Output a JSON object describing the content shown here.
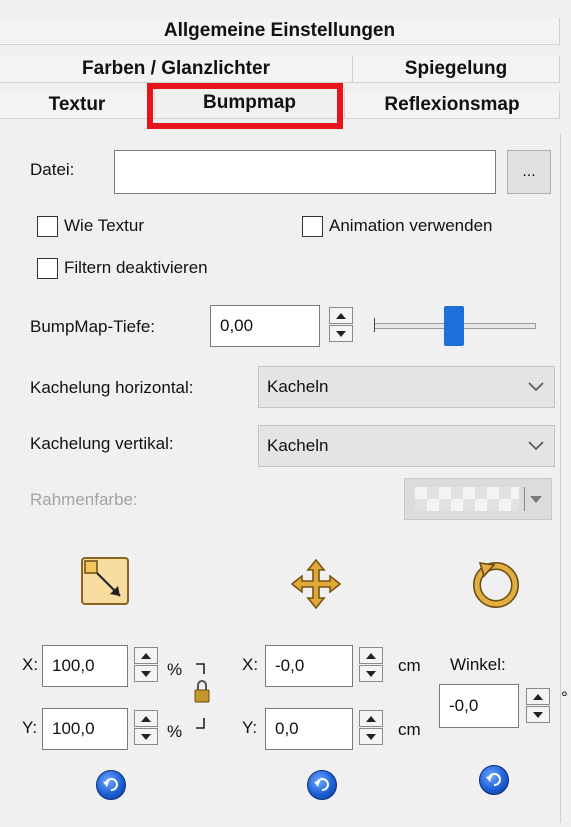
{
  "tabs": {
    "row1": [
      {
        "label": "Allgemeine Einstellungen"
      }
    ],
    "row2": [
      {
        "label": "Farben / Glanzlichter"
      },
      {
        "label": "Spiegelung"
      }
    ],
    "row3": [
      {
        "label": "Textur"
      },
      {
        "label": "Bumpmap",
        "active": true
      },
      {
        "label": "Reflexionsmap"
      }
    ]
  },
  "file": {
    "label": "Datei:",
    "value": "",
    "browse": "..."
  },
  "checkboxes": {
    "wie_textur": "Wie Textur",
    "animation": "Animation verwenden",
    "filtern": "Filtern deaktivieren"
  },
  "bump_depth": {
    "label": "BumpMap-Tiefe:",
    "value": "0,00",
    "slider_fraction": 0.5
  },
  "tiling_h": {
    "label": "Kachelung horizontal:",
    "value": "Kacheln"
  },
  "tiling_v": {
    "label": "Kachelung vertikal:",
    "value": "Kacheln"
  },
  "frame_color": {
    "label": "Rahmenfarbe:"
  },
  "scale": {
    "x_label": "X:",
    "x_value": "100,0",
    "x_unit": "%",
    "y_label": "Y:",
    "y_value": "100,0",
    "y_unit": "%"
  },
  "move": {
    "x_label": "X:",
    "x_value": "-0,0",
    "x_unit": "cm",
    "y_label": "Y:",
    "y_value": "0,0",
    "y_unit": "cm"
  },
  "rotate": {
    "label": "Winkel:",
    "value": "-0,0",
    "unit": "°"
  },
  "colors": {
    "highlight": "#e8141c",
    "slider_thumb": "#1e6fd9",
    "icon_gold": "#c8962e"
  }
}
